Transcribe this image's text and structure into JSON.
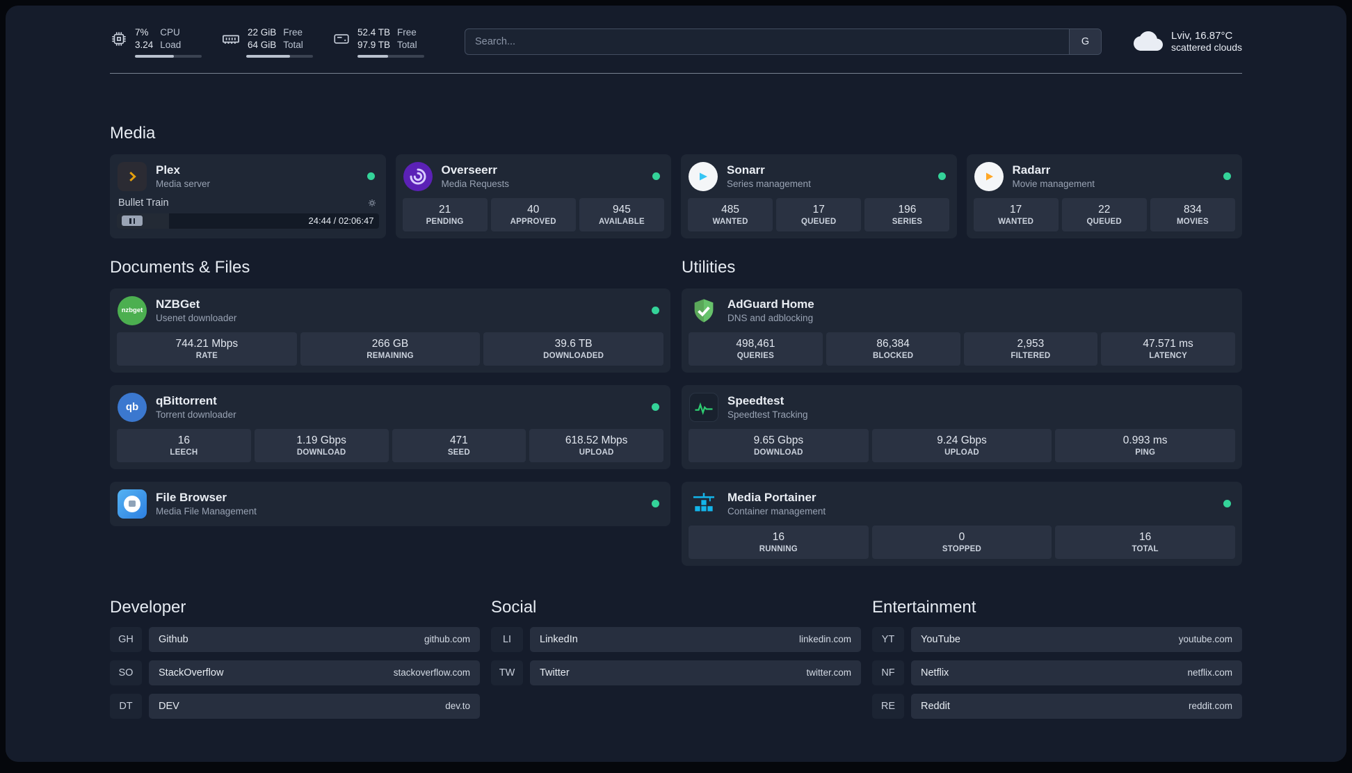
{
  "colors": {
    "status_online": "#34D399",
    "page_background": "#151C2B",
    "card_background": "#1F2735",
    "stat_background": "#2A3242",
    "accent_plex": "#E5A00D",
    "accent_overseerr": "#5B21B6",
    "accent_sonarr": "#35C5F4",
    "accent_radarr": "#FFA726",
    "accent_nzbget": "#4CAF50",
    "accent_qbittorrent": "#3B78CF",
    "accent_filebrowser": "#2D7FE0",
    "accent_adguard": "#5BA85A",
    "accent_speedtest": "#2ECC71",
    "accent_portainer": "#13B5EA"
  },
  "topbar": {
    "cpu": {
      "value_top": "7%",
      "value_bottom": "3.24",
      "label_top": "CPU",
      "label_bottom": "Load",
      "progress_pct": 58
    },
    "memory": {
      "value_top": "22 GiB",
      "value_bottom": "64 GiB",
      "label_top": "Free",
      "label_bottom": "Total",
      "progress_pct": 66
    },
    "disk": {
      "value_top": "52.4 TB",
      "value_bottom": "97.9 TB",
      "label_top": "Free",
      "label_bottom": "Total",
      "progress_pct": 46
    },
    "search": {
      "placeholder": "Search...",
      "provider_label": "G"
    },
    "weather": {
      "location": "Lviv, 16.87°C",
      "condition": "scattered clouds"
    }
  },
  "sections": {
    "media": {
      "title": "Media",
      "plex": {
        "name": "Plex",
        "subtitle": "Media server",
        "now_playing": "Bullet Train",
        "time": "24:44 / 02:06:47",
        "progress_pct": 20
      },
      "overseerr": {
        "name": "Overseerr",
        "subtitle": "Media Requests",
        "stats": [
          {
            "value": "21",
            "label": "PENDING"
          },
          {
            "value": "40",
            "label": "APPROVED"
          },
          {
            "value": "945",
            "label": "AVAILABLE"
          }
        ]
      },
      "sonarr": {
        "name": "Sonarr",
        "subtitle": "Series management",
        "stats": [
          {
            "value": "485",
            "label": "WANTED"
          },
          {
            "value": "17",
            "label": "QUEUED"
          },
          {
            "value": "196",
            "label": "SERIES"
          }
        ]
      },
      "radarr": {
        "name": "Radarr",
        "subtitle": "Movie management",
        "stats": [
          {
            "value": "17",
            "label": "WANTED"
          },
          {
            "value": "22",
            "label": "QUEUED"
          },
          {
            "value": "834",
            "label": "MOVIES"
          }
        ]
      }
    },
    "documents": {
      "title": "Documents & Files",
      "nzbget": {
        "name": "NZBGet",
        "subtitle": "Usenet downloader",
        "icon_text": "nzbget",
        "stats": [
          {
            "value": "744.21 Mbps",
            "label": "RATE"
          },
          {
            "value": "266 GB",
            "label": "REMAINING"
          },
          {
            "value": "39.6 TB",
            "label": "DOWNLOADED"
          }
        ]
      },
      "qbittorrent": {
        "name": "qBittorrent",
        "subtitle": "Torrent downloader",
        "icon_text": "qb",
        "stats": [
          {
            "value": "16",
            "label": "LEECH"
          },
          {
            "value": "1.19 Gbps",
            "label": "DOWNLOAD"
          },
          {
            "value": "471",
            "label": "SEED"
          },
          {
            "value": "618.52 Mbps",
            "label": "UPLOAD"
          }
        ]
      },
      "filebrowser": {
        "name": "File Browser",
        "subtitle": "Media File Management"
      }
    },
    "utilities": {
      "title": "Utilities",
      "adguard": {
        "name": "AdGuard Home",
        "subtitle": "DNS and adblocking",
        "stats": [
          {
            "value": "498,461",
            "label": "QUERIES"
          },
          {
            "value": "86,384",
            "label": "BLOCKED"
          },
          {
            "value": "2,953",
            "label": "FILTERED"
          },
          {
            "value": "47.571 ms",
            "label": "LATENCY"
          }
        ]
      },
      "speedtest": {
        "name": "Speedtest",
        "subtitle": "Speedtest Tracking",
        "stats": [
          {
            "value": "9.65 Gbps",
            "label": "DOWNLOAD"
          },
          {
            "value": "9.24 Gbps",
            "label": "UPLOAD"
          },
          {
            "value": "0.993 ms",
            "label": "PING"
          }
        ]
      },
      "portainer": {
        "name": "Media Portainer",
        "subtitle": "Container management",
        "stats": [
          {
            "value": "16",
            "label": "RUNNING"
          },
          {
            "value": "0",
            "label": "STOPPED"
          },
          {
            "value": "16",
            "label": "TOTAL"
          }
        ]
      }
    }
  },
  "bookmarks": {
    "developer": {
      "title": "Developer",
      "items": [
        {
          "abbr": "GH",
          "name": "Github",
          "domain": "github.com"
        },
        {
          "abbr": "SO",
          "name": "StackOverflow",
          "domain": "stackoverflow.com"
        },
        {
          "abbr": "DT",
          "name": "DEV",
          "domain": "dev.to"
        }
      ]
    },
    "social": {
      "title": "Social",
      "items": [
        {
          "abbr": "LI",
          "name": "LinkedIn",
          "domain": "linkedin.com"
        },
        {
          "abbr": "TW",
          "name": "Twitter",
          "domain": "twitter.com"
        }
      ]
    },
    "entertainment": {
      "title": "Entertainment",
      "items": [
        {
          "abbr": "YT",
          "name": "YouTube",
          "domain": "youtube.com"
        },
        {
          "abbr": "NF",
          "name": "Netflix",
          "domain": "netflix.com"
        },
        {
          "abbr": "RE",
          "name": "Reddit",
          "domain": "reddit.com"
        }
      ]
    }
  }
}
